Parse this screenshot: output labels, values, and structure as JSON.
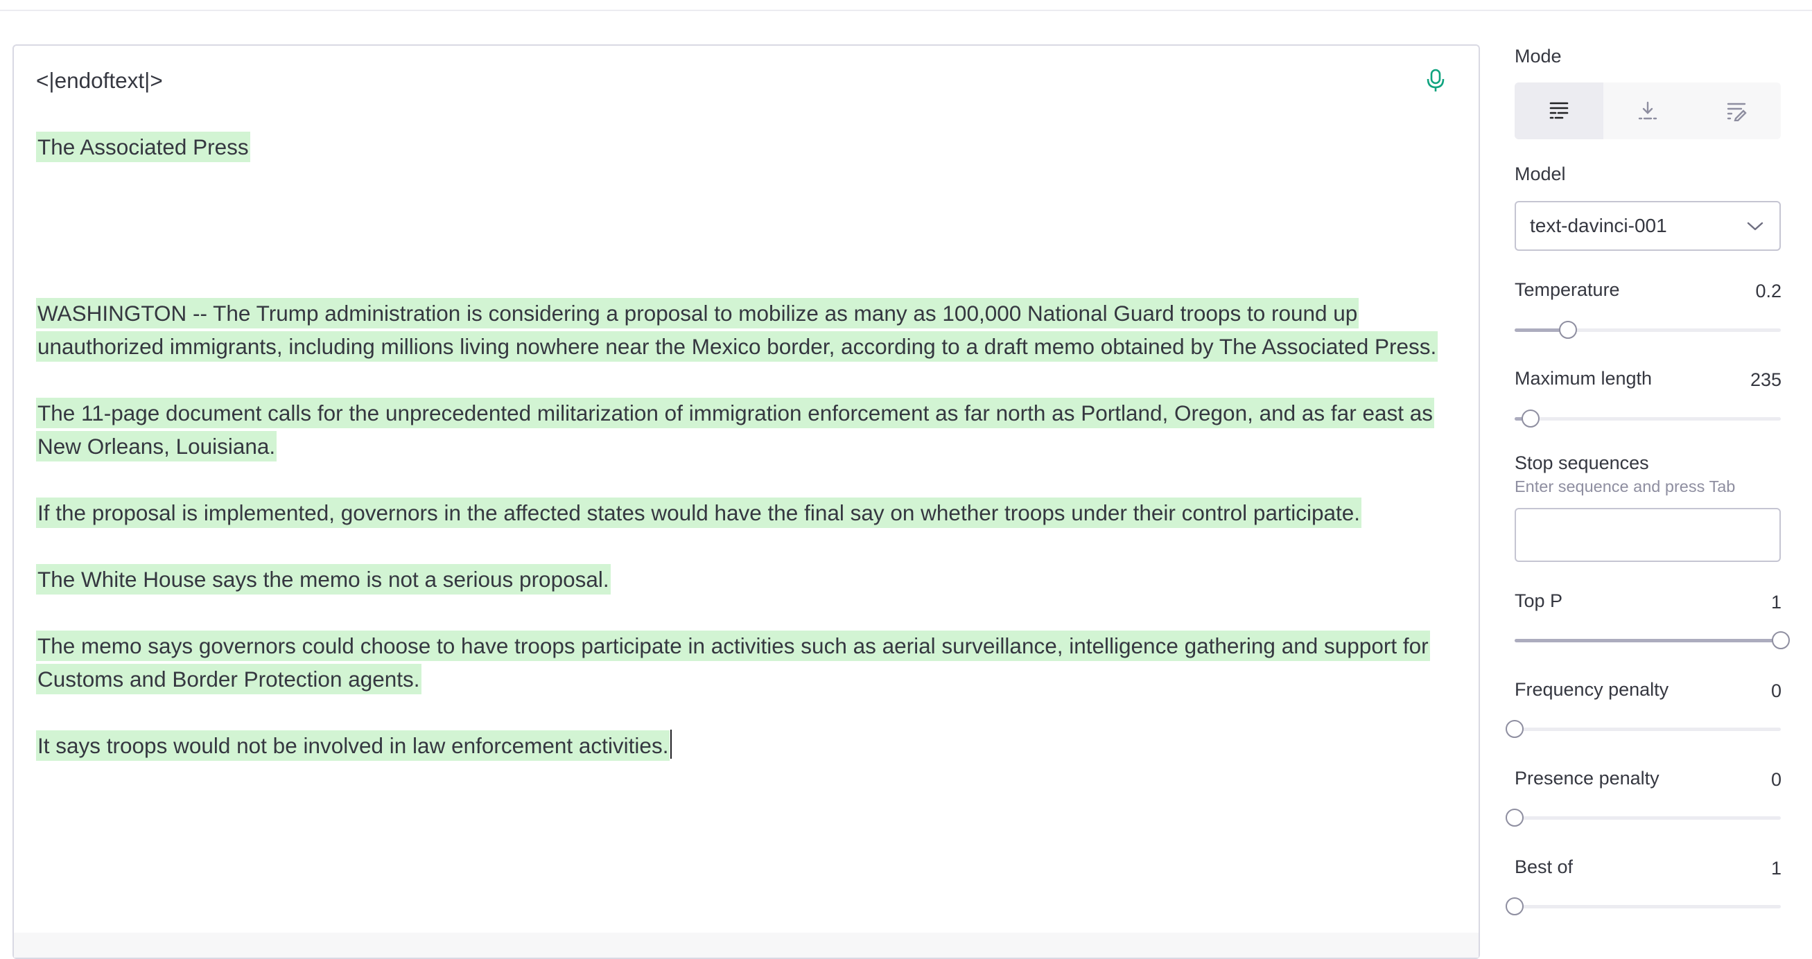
{
  "editor": {
    "paragraphs": [
      {
        "text": "<|endoftext|>",
        "highlighted": false
      },
      {
        "text": "The Associated Press",
        "highlighted": true
      },
      {
        "text": "WASHINGTON -- The Trump administration is considering a proposal to mobilize as many as 100,000 National Guard troops to round up unauthorized immigrants, including millions living nowhere near the Mexico border, according to a draft memo obtained by The Associated Press.",
        "highlighted": true
      },
      {
        "text": "The 11-page document calls for the unprecedented militarization of immigration enforcement as far north as Portland, Oregon, and as far east as New Orleans, Louisiana.",
        "highlighted": true
      },
      {
        "text": "If the proposal is implemented, governors in the affected states would have the final say on whether troops under their control participate.",
        "highlighted": true
      },
      {
        "text": "The White House says the memo is not a serious proposal.",
        "highlighted": true
      },
      {
        "text": "The memo says governors could choose to have troops participate in activities such as aerial surveillance, intelligence gathering and support for Customs and Border Protection agents.",
        "highlighted": true
      },
      {
        "text": "It says troops would not be involved in law enforcement activities.",
        "highlighted": true
      }
    ],
    "mic_icon": "microphone-icon",
    "highlight_color": "#d2f4d3"
  },
  "panel": {
    "mode": {
      "label": "Mode",
      "options": [
        {
          "icon": "complete-mode-icon",
          "active": true
        },
        {
          "icon": "insert-mode-icon",
          "active": false
        },
        {
          "icon": "edit-mode-icon",
          "active": false
        }
      ]
    },
    "model": {
      "label": "Model",
      "value": "text-davinci-001",
      "icon": "chevron-down-icon"
    },
    "temperature": {
      "label": "Temperature",
      "value": "0.2",
      "fraction": 0.2
    },
    "max_length": {
      "label": "Maximum length",
      "value": "235",
      "fraction": 0.059
    },
    "stop_sequences": {
      "label": "Stop sequences",
      "hint": "Enter sequence and press Tab",
      "value": ""
    },
    "top_p": {
      "label": "Top P",
      "value": "1",
      "fraction": 1
    },
    "frequency_penalty": {
      "label": "Frequency penalty",
      "value": "0",
      "fraction": 0
    },
    "presence_penalty": {
      "label": "Presence penalty",
      "value": "0",
      "fraction": 0
    },
    "best_of": {
      "label": "Best of",
      "value": "1",
      "fraction": 0
    }
  }
}
